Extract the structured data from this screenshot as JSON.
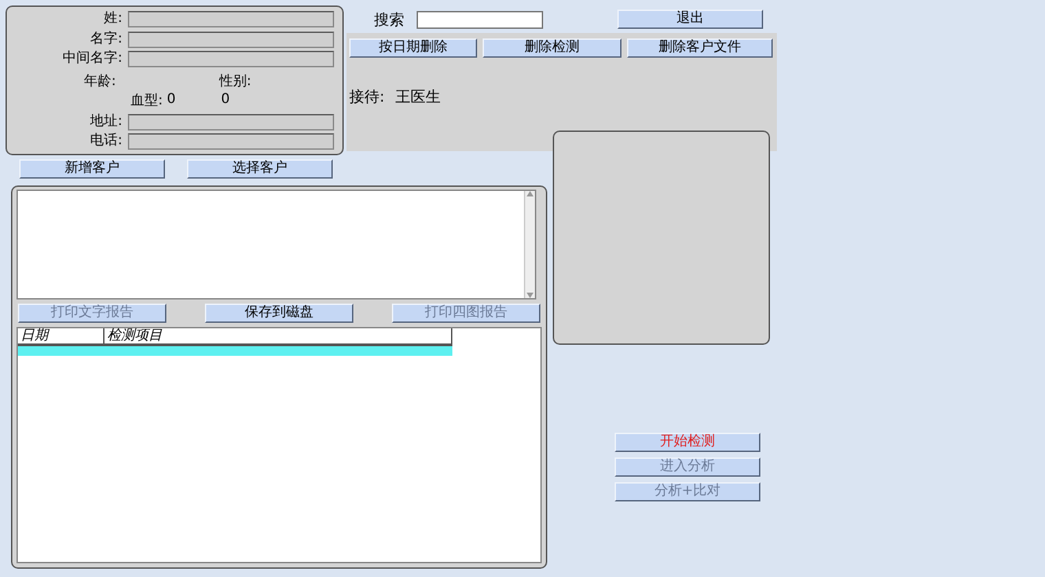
{
  "customer_form": {
    "rows": [
      {
        "kind": "field",
        "label": "姓:"
      },
      {
        "kind": "field",
        "label": "名字:"
      },
      {
        "kind": "field",
        "label": "中间名字:"
      },
      {
        "kind": "age_sex",
        "age_label": "年龄:",
        "sex_label": "性别:"
      },
      {
        "kind": "blood",
        "label": "血型:",
        "value": "0",
        "value_2": "0"
      },
      {
        "kind": "field",
        "label": "地址:"
      },
      {
        "kind": "field",
        "label": "电话:"
      }
    ]
  },
  "customer_buttons": [
    {
      "label": "新增客户",
      "disabled": false
    },
    {
      "label": "选择客户",
      "disabled": false
    }
  ],
  "search": {
    "label": "搜索"
  },
  "exit_button": {
    "label": "退出",
    "disabled": false
  },
  "toolbar_buttons": [
    {
      "label": "按日期删除",
      "disabled": false
    },
    {
      "label": "删除检测",
      "disabled": false
    },
    {
      "label": "删除客户文件",
      "disabled": false
    }
  ],
  "reception": {
    "label": "接待:",
    "value": "王医生"
  },
  "report_buttons": [
    {
      "label": "打印文字报告",
      "disabled": true
    },
    {
      "label": "保存到磁盘",
      "disabled": false
    },
    {
      "label": "打印四图报告",
      "disabled": true
    }
  ],
  "table": {
    "columns": [
      "日期",
      "检测项目"
    ],
    "rows": [
      {
        "selected": true
      }
    ]
  },
  "action_buttons": [
    {
      "label": "开始检测",
      "disabled": false,
      "highlight": true
    },
    {
      "label": "进入分析",
      "disabled": true,
      "highlight": false
    },
    {
      "label": "分析+比对",
      "disabled": true,
      "highlight": false
    }
  ]
}
